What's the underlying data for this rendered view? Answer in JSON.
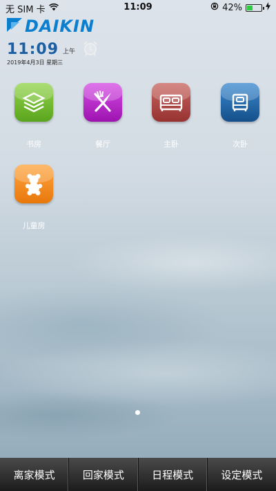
{
  "status_bar": {
    "carrier": "无 SIM 卡",
    "time": "11:09",
    "battery_percent": "42%",
    "battery_level": 0.42,
    "icons": [
      "wifi-icon",
      "rotation-lock-icon",
      "battery-icon",
      "charging-icon"
    ]
  },
  "header": {
    "brand": "DAIKIN",
    "clock_time": "11:09",
    "am_pm": "上午",
    "date": "2019年4月3日 星期三",
    "alarm_icon": "alarm-clock-icon"
  },
  "rooms": [
    {
      "label": "书房",
      "icon": "layers-icon",
      "color": "#6fbf2a"
    },
    {
      "label": "餐厅",
      "icon": "fork-knife-icon",
      "color": "#b51fc8"
    },
    {
      "label": "主卧",
      "icon": "double-bed-icon",
      "color": "#a8403c"
    },
    {
      "label": "次卧",
      "icon": "single-bed-icon",
      "color": "#1b65a6"
    },
    {
      "label": "儿童房",
      "icon": "teddy-bear-icon",
      "color": "#f08a16"
    }
  ],
  "pager": {
    "current_page": 1,
    "total_pages": 1
  },
  "bottom_bar": {
    "modes": [
      "离家模式",
      "回家模式",
      "日程模式",
      "设定模式"
    ]
  }
}
